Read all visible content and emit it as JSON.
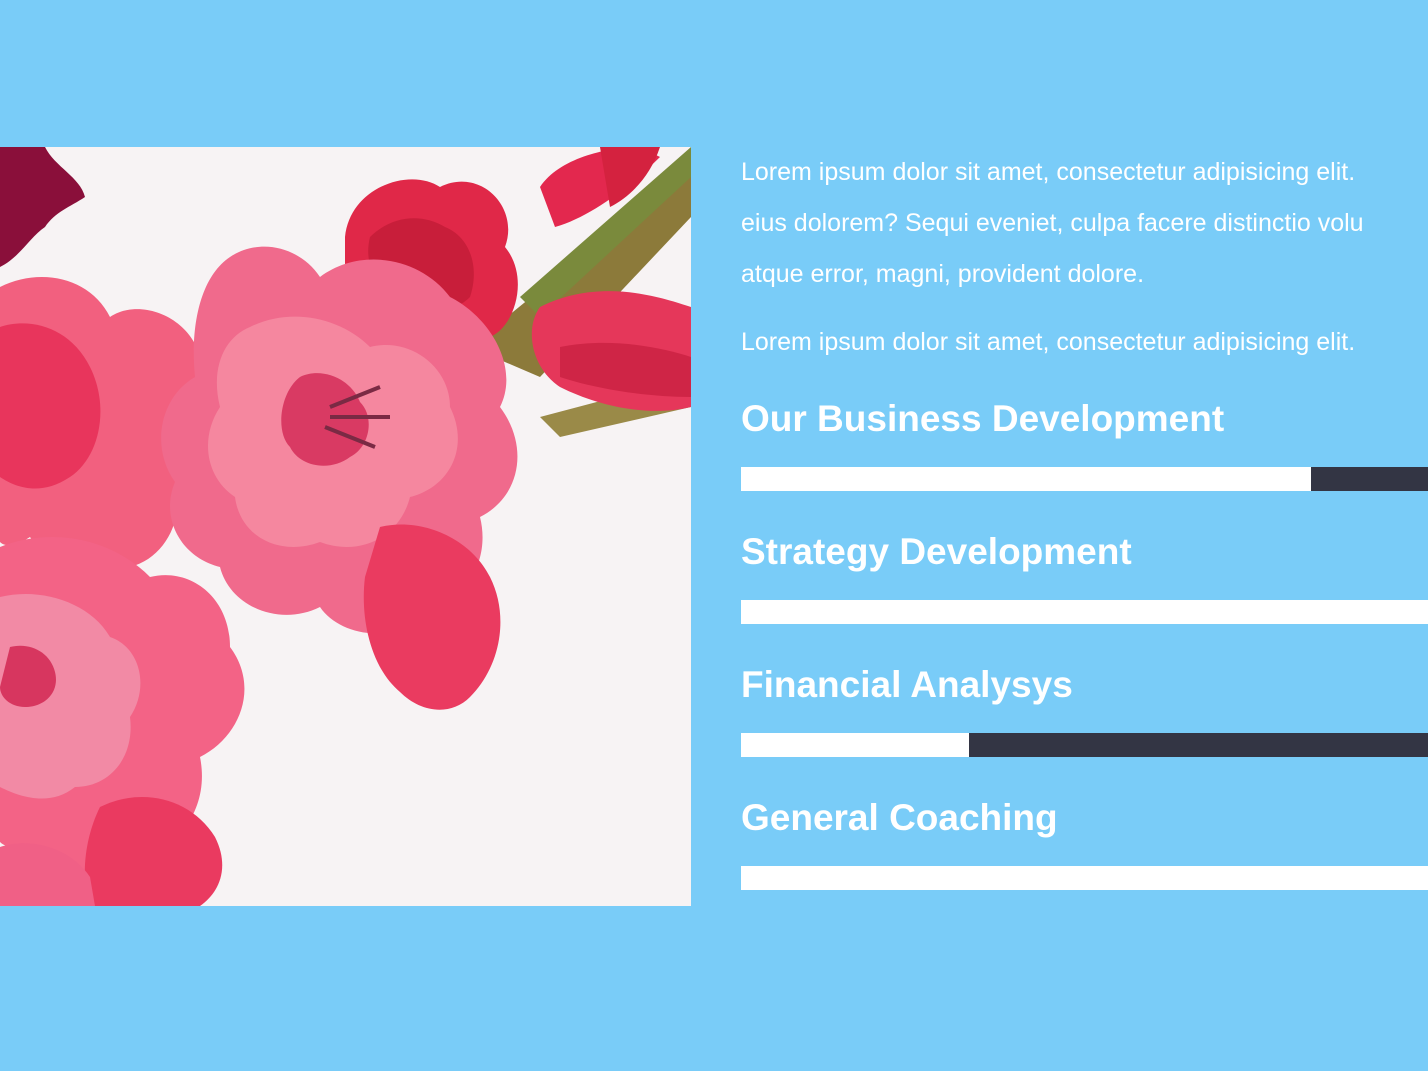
{
  "about": {
    "paragraphs": [
      {
        "lines": [
          "Lorem ipsum dolor sit amet, consectetur adipisicing elit. ",
          "eius dolorem? Sequi eveniet, culpa facere distinctio volu",
          "atque error, magni, provident dolore."
        ]
      },
      {
        "lines": [
          "Lorem ipsum dolor sit amet, consectetur adipisicing elit. "
        ]
      }
    ]
  },
  "skills": [
    {
      "label": "Our Business Development",
      "percent": 81.4
    },
    {
      "label": "Strategy Development",
      "percent": 100
    },
    {
      "label": "Financial Analysys",
      "percent": 32.6
    },
    {
      "label": "General Coaching",
      "percent": 100
    }
  ],
  "colors": {
    "background": "#79ccf8",
    "bar_fill": "#ffffff",
    "bar_track": "#333544",
    "text": "#ffffff"
  },
  "image": {
    "subject": "pink and red gladiolus flowers on white background"
  }
}
